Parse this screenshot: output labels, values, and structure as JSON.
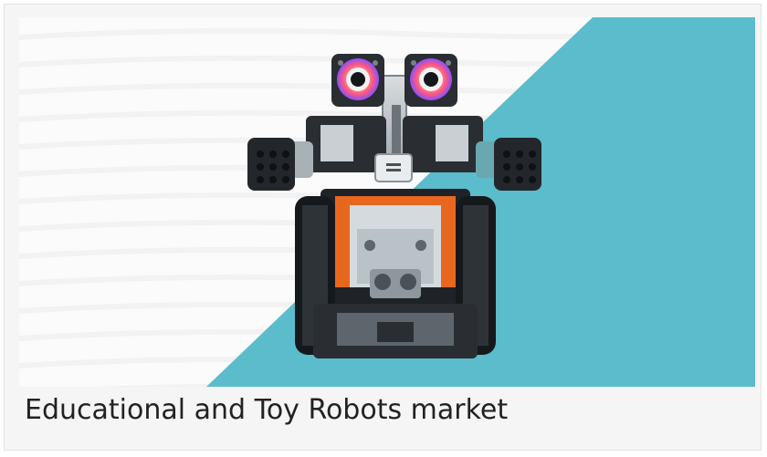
{
  "card": {
    "image_subject": "robot-toy-image",
    "caption": "Educational and Toy Robots market"
  },
  "colors": {
    "card_background": "#f5f5f5",
    "card_border": "#e3e3e3",
    "accent_teal": "#5bbccb",
    "robot_orange": "#e8671f",
    "robot_dark": "#1f2328",
    "eye_ring": "#ff4f6d"
  }
}
